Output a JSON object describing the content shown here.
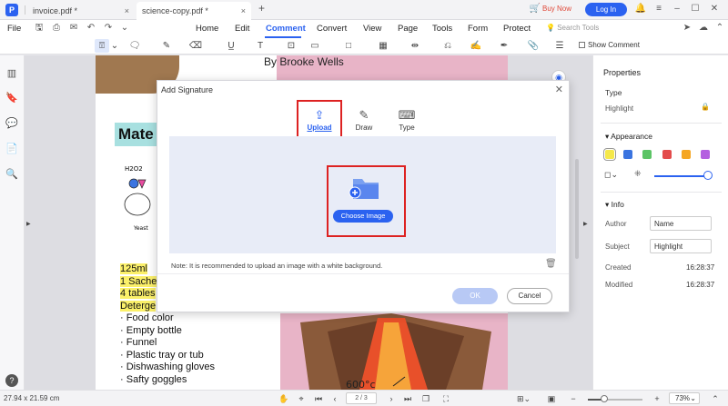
{
  "titlebar": {
    "logo": "P",
    "tabs": [
      {
        "label": "invoice.pdf *",
        "close": "×"
      },
      {
        "label": "science-copy.pdf *",
        "close": "×"
      }
    ],
    "new_tab": "+",
    "buy_now": "Buy Now",
    "login": "Log In"
  },
  "menubar": {
    "file": "File",
    "items": [
      "Home",
      "Edit",
      "Comment",
      "Convert",
      "View",
      "Page",
      "Tools",
      "Form",
      "Protect"
    ],
    "active": "Comment",
    "search_placeholder": "Search Tools"
  },
  "toolbar": {
    "show_comment": "Show Comment"
  },
  "document": {
    "author": "By Brooke Wells",
    "heading": "Mate",
    "doodle_label": "H2O2",
    "doodle_sub": "Yeast",
    "list_highlighted": [
      "125ml",
      "1 Sache",
      "4 tables",
      "Deterge"
    ],
    "list": [
      "Food color",
      "Empty bottle",
      "Funnel",
      "Plastic tray or tub",
      "Dishwashing gloves",
      "Safty goggles"
    ],
    "volcano_label": "600°c"
  },
  "dialog": {
    "title": "Add Signature",
    "tabs": [
      {
        "label": "Upload",
        "icon": "upload-icon",
        "glyph": "⇪"
      },
      {
        "label": "Draw",
        "icon": "draw-icon",
        "glyph": "✎"
      },
      {
        "label": "Type",
        "icon": "keyboard-icon",
        "glyph": "⌨"
      }
    ],
    "choose_image": "Choose Image",
    "note": "Note: It is recommended to upload an image with a white background.",
    "ok": "OK",
    "cancel": "Cancel"
  },
  "properties": {
    "title": "Properties",
    "type_label": "Type",
    "type_value": "Highlight",
    "appearance": "Appearance",
    "colors": [
      "#f5e84a",
      "#3b74e0",
      "#5cc466",
      "#e34c4c",
      "#f5a623",
      "#b45fe0"
    ],
    "info": "Info",
    "author_label": "Author",
    "author_value": "Name",
    "subject_label": "Subject",
    "subject_value": "Highlight",
    "created_label": "Created",
    "created_value": "16:28:37",
    "modified_label": "Modified",
    "modified_value": "16:28:37"
  },
  "statusbar": {
    "dimensions": "27.94 x 21.59 cm",
    "page": "2 / 3",
    "zoom": "73%",
    "zoom_fraction": 0.3
  }
}
